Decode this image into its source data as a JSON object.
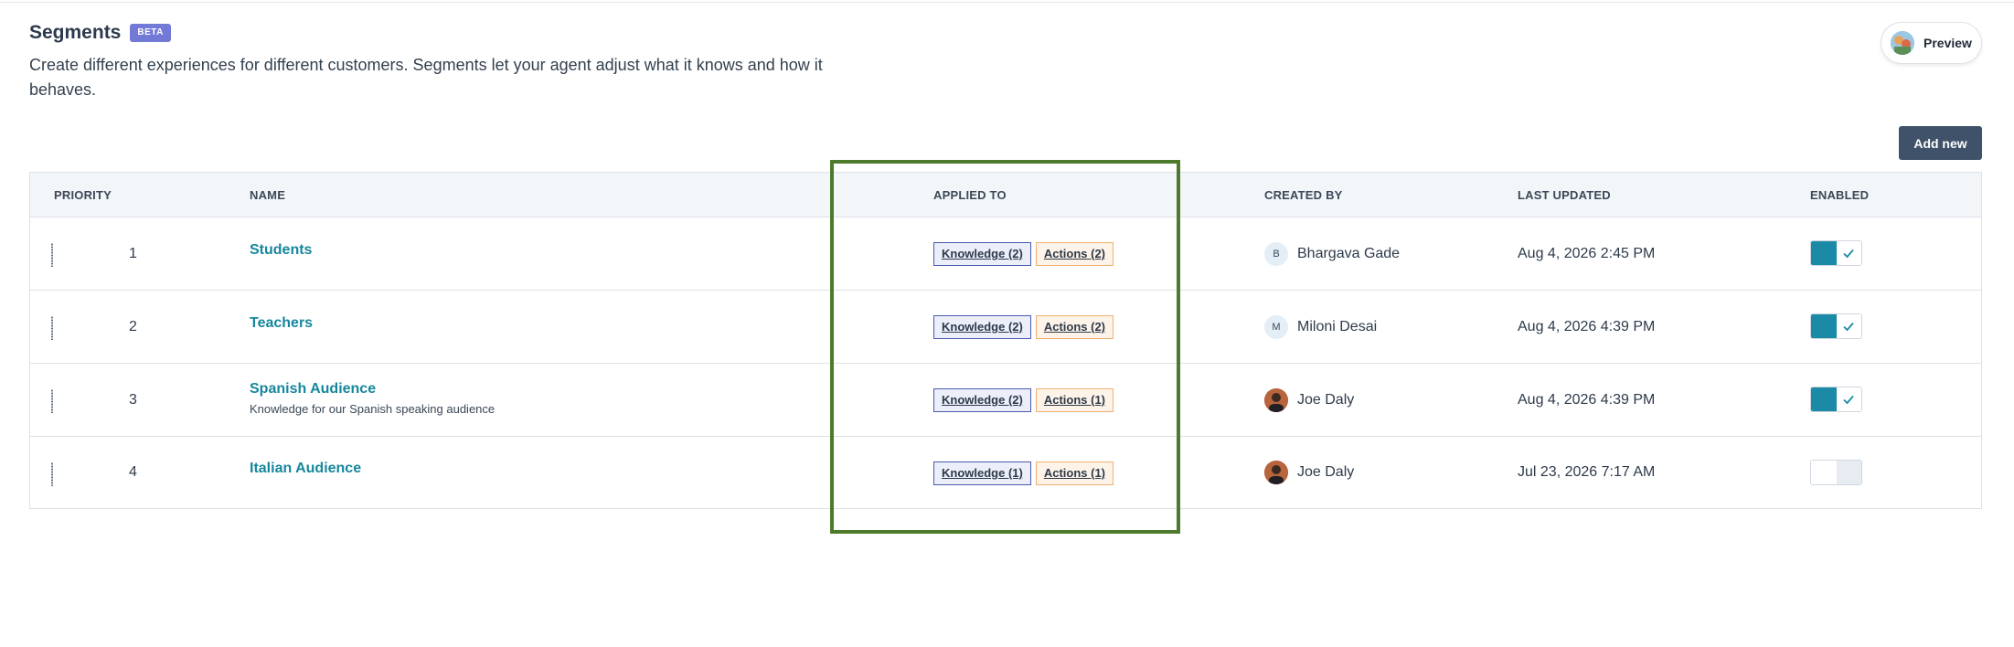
{
  "page": {
    "title": "Segments",
    "badge": "BETA",
    "description": "Create different experiences for different customers. Segments let your agent adjust what it knows and how it behaves."
  },
  "toolbar": {
    "preview_label": "Preview",
    "add_new_label": "Add new"
  },
  "table": {
    "columns": [
      "PRIORITY",
      "NAME",
      "APPLIED TO",
      "CREATED BY",
      "LAST UPDATED",
      "ENABLED"
    ],
    "rows": [
      {
        "priority": "1",
        "name": "Students",
        "subtitle": "",
        "knowledge": "Knowledge (2)",
        "actions": "Actions (2)",
        "created_by": "Bhargava Gade",
        "avatar_initial": "B",
        "last_updated": "Aug 4, 2026 2:45 PM",
        "enabled": true
      },
      {
        "priority": "2",
        "name": "Teachers",
        "subtitle": "",
        "knowledge": "Knowledge (2)",
        "actions": "Actions (2)",
        "created_by": "Miloni Desai",
        "avatar_initial": "M",
        "last_updated": "Aug 4, 2026 4:39 PM",
        "enabled": true
      },
      {
        "priority": "3",
        "name": "Spanish Audience",
        "subtitle": "Knowledge for our Spanish speaking audience",
        "knowledge": "Knowledge (2)",
        "actions": "Actions (1)",
        "created_by": "Joe Daly",
        "avatar_initial": "",
        "last_updated": "Aug 4, 2026 4:39 PM",
        "enabled": true
      },
      {
        "priority": "4",
        "name": "Italian Audience",
        "subtitle": "",
        "knowledge": "Knowledge (1)",
        "actions": "Actions (1)",
        "created_by": "Joe Daly",
        "avatar_initial": "",
        "last_updated": "Jul 23, 2026 7:17 AM",
        "enabled": false
      }
    ]
  },
  "colors": {
    "accent": "#1b8aa6",
    "link": "#16879c",
    "badge": "#7379d6",
    "add_button": "#3f5269",
    "highlight": "#4e7a2c"
  }
}
